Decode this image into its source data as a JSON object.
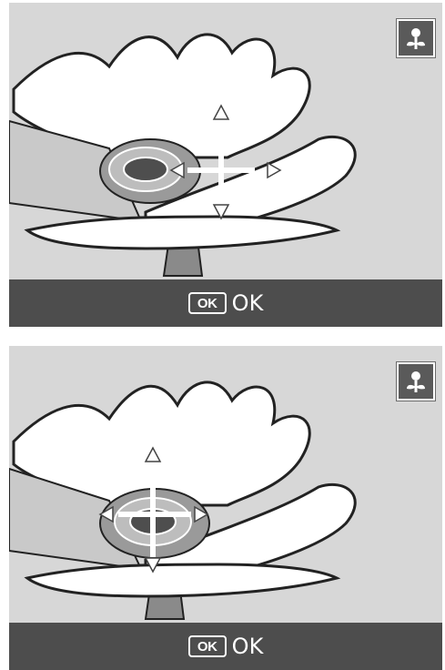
{
  "screens": [
    {
      "ok_bar": {
        "ok_icon_label": "OK",
        "ok_text": "OK"
      },
      "mode_icon": "macro-flower-icon",
      "focus_target_position": "offset-right"
    },
    {
      "ok_bar": {
        "ok_icon_label": "OK",
        "ok_text": "OK"
      },
      "mode_icon": "macro-flower-icon",
      "focus_target_position": "centered"
    }
  ]
}
